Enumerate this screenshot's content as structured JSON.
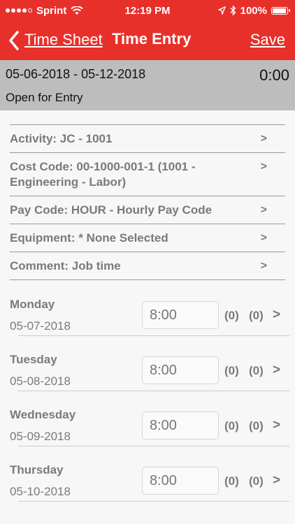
{
  "status_bar": {
    "carrier": "Sprint",
    "time": "12:19 PM",
    "battery": "100%",
    "battery_level": 1.0
  },
  "nav": {
    "back_label": "Time Sheet",
    "title": "Time Entry",
    "save_label": "Save"
  },
  "period": {
    "range": "05-06-2018 - 05-12-2018",
    "total": "0:00",
    "status": "Open for Entry"
  },
  "details": [
    {
      "label": "Activity: JC - 1001",
      "chevron": ">"
    },
    {
      "label": "Cost Code: 00-1000-001-1 (1001 - Engineering - Labor)",
      "chevron": ">"
    },
    {
      "label": "Pay Code: HOUR - Hourly Pay Code",
      "chevron": ">"
    },
    {
      "label": "Equipment: * None Selected",
      "chevron": ">"
    },
    {
      "label": "Comment: Job time",
      "chevron": ">"
    }
  ],
  "days": [
    {
      "name": "Monday",
      "date": "05-07-2018",
      "hours": "8:00",
      "count_a": "(0)",
      "count_b": "(0)",
      "chevron": ">"
    },
    {
      "name": "Tuesday",
      "date": "05-08-2018",
      "hours": "8:00",
      "count_a": "(0)",
      "count_b": "(0)",
      "chevron": ">"
    },
    {
      "name": "Wednesday",
      "date": "05-09-2018",
      "hours": "8:00",
      "count_a": "(0)",
      "count_b": "(0)",
      "chevron": ">"
    },
    {
      "name": "Thursday",
      "date": "05-10-2018",
      "hours": "8:00",
      "count_a": "(0)",
      "count_b": "(0)",
      "chevron": ">"
    }
  ],
  "colors": {
    "brand_red": "#e8302a",
    "header_gray": "#bdbdbd"
  }
}
